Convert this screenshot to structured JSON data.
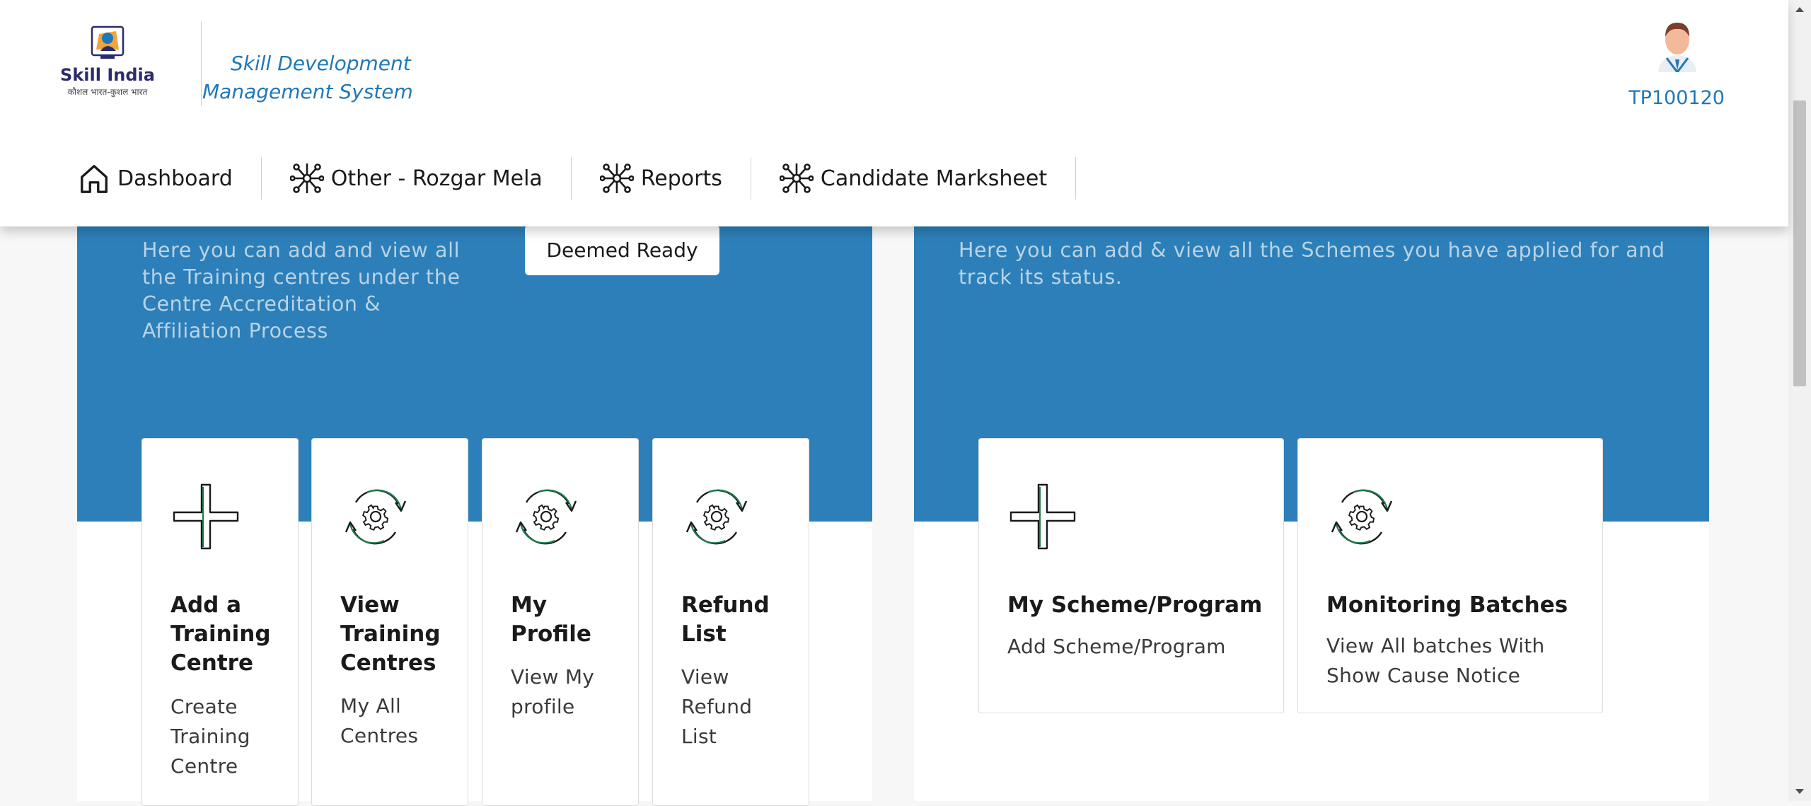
{
  "header": {
    "logo_text": "Skill India",
    "logo_tagline": "कौशल भारत-कुशल भारत",
    "app_title": "Skill Development Management System",
    "user_id": "TP100120"
  },
  "nav": {
    "items": [
      {
        "label": "Dashboard",
        "icon": "home-icon"
      },
      {
        "label": "Other - Rozgar Mela",
        "icon": "network-icon"
      },
      {
        "label": "Reports",
        "icon": "network-icon"
      },
      {
        "label": "Candidate Marksheet",
        "icon": "network-icon"
      }
    ]
  },
  "left_panel": {
    "description": "Here you can add and view all the Training centres under the Centre Accreditation & Affiliation Process",
    "deemed_button": "Deemed Ready",
    "cards": [
      {
        "title": "Add a Training Centre",
        "subtitle": "Create Training Centre",
        "icon": "plus-icon"
      },
      {
        "title": "View Training Centres",
        "subtitle": "My All Centres",
        "icon": "refresh-gear-icon"
      },
      {
        "title": "My Profile",
        "subtitle": "View My profile",
        "icon": "refresh-gear-icon"
      },
      {
        "title": "Refund List",
        "subtitle": "View Refund List",
        "icon": "refresh-gear-icon"
      }
    ]
  },
  "right_panel": {
    "description": "Here you can add & view all the Schemes you have applied for and track its status.",
    "cards": [
      {
        "title": "My Scheme/Program",
        "subtitle": "Add Scheme/Program",
        "icon": "plus-icon"
      },
      {
        "title": "Monitoring Batches",
        "subtitle": "View All batches With Show Cause Notice",
        "icon": "refresh-gear-icon"
      }
    ]
  },
  "colors": {
    "panel_blue": "#2c7fb8",
    "accent_blue": "#1f78b8",
    "icon_green": "#1d7a4c"
  }
}
